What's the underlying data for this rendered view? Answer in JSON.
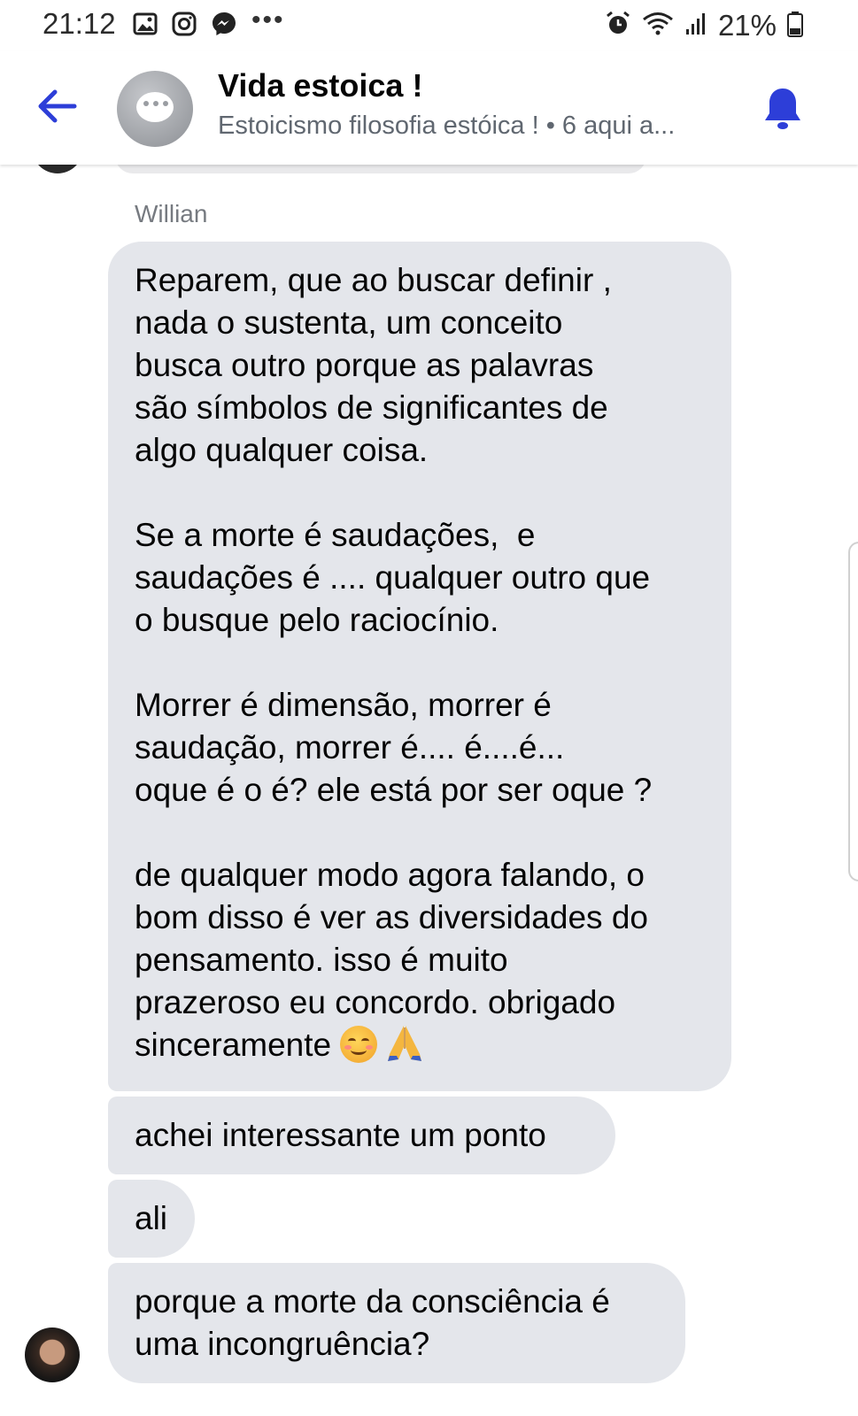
{
  "status_bar": {
    "time": "21:12",
    "left_icons": [
      "gallery-icon",
      "instagram-icon",
      "messenger-icon",
      "more-icon"
    ],
    "more": "•••",
    "right_icons": [
      "alarm-icon",
      "wifi-icon",
      "signal-icon",
      "battery-icon"
    ],
    "battery": "21%"
  },
  "header": {
    "title": "Vida estoica !",
    "subtitle": "Estoicismo  filosofia estóica ! • 6 aqui a...",
    "accent_color": "#2d3ed8"
  },
  "conversation": {
    "sender_name": "Willian",
    "messages": [
      {
        "text": "Reparem, que ao buscar definir ,\nnada o sustenta, um conceito\nbusca outro porque as palavras\nsão símbolos de significantes de\nalgo qualquer coisa.\n\nSe a morte é saudações,  e\nsaudações é .... qualquer outro que\no busque pelo raciocínio.\n\nMorrer é dimensão, morrer é\nsaudação, morrer é.... é....é...\noque é o é? ele está por ser oque ?\n\nde qualquer modo agora falando, o\nbom disso é ver as diversidades do\npensamento. isso é muito\nprazeroso eu concordo. obrigado\nsinceramente ",
        "emojis": [
          "smiling-face-emoji",
          "folded-hands-emoji"
        ]
      },
      {
        "text": "achei interessante um ponto"
      },
      {
        "text": "ali"
      },
      {
        "text": "porque a morte da consciência é\numa incongruência?"
      }
    ],
    "bubble_color": "#e4e6eb"
  }
}
